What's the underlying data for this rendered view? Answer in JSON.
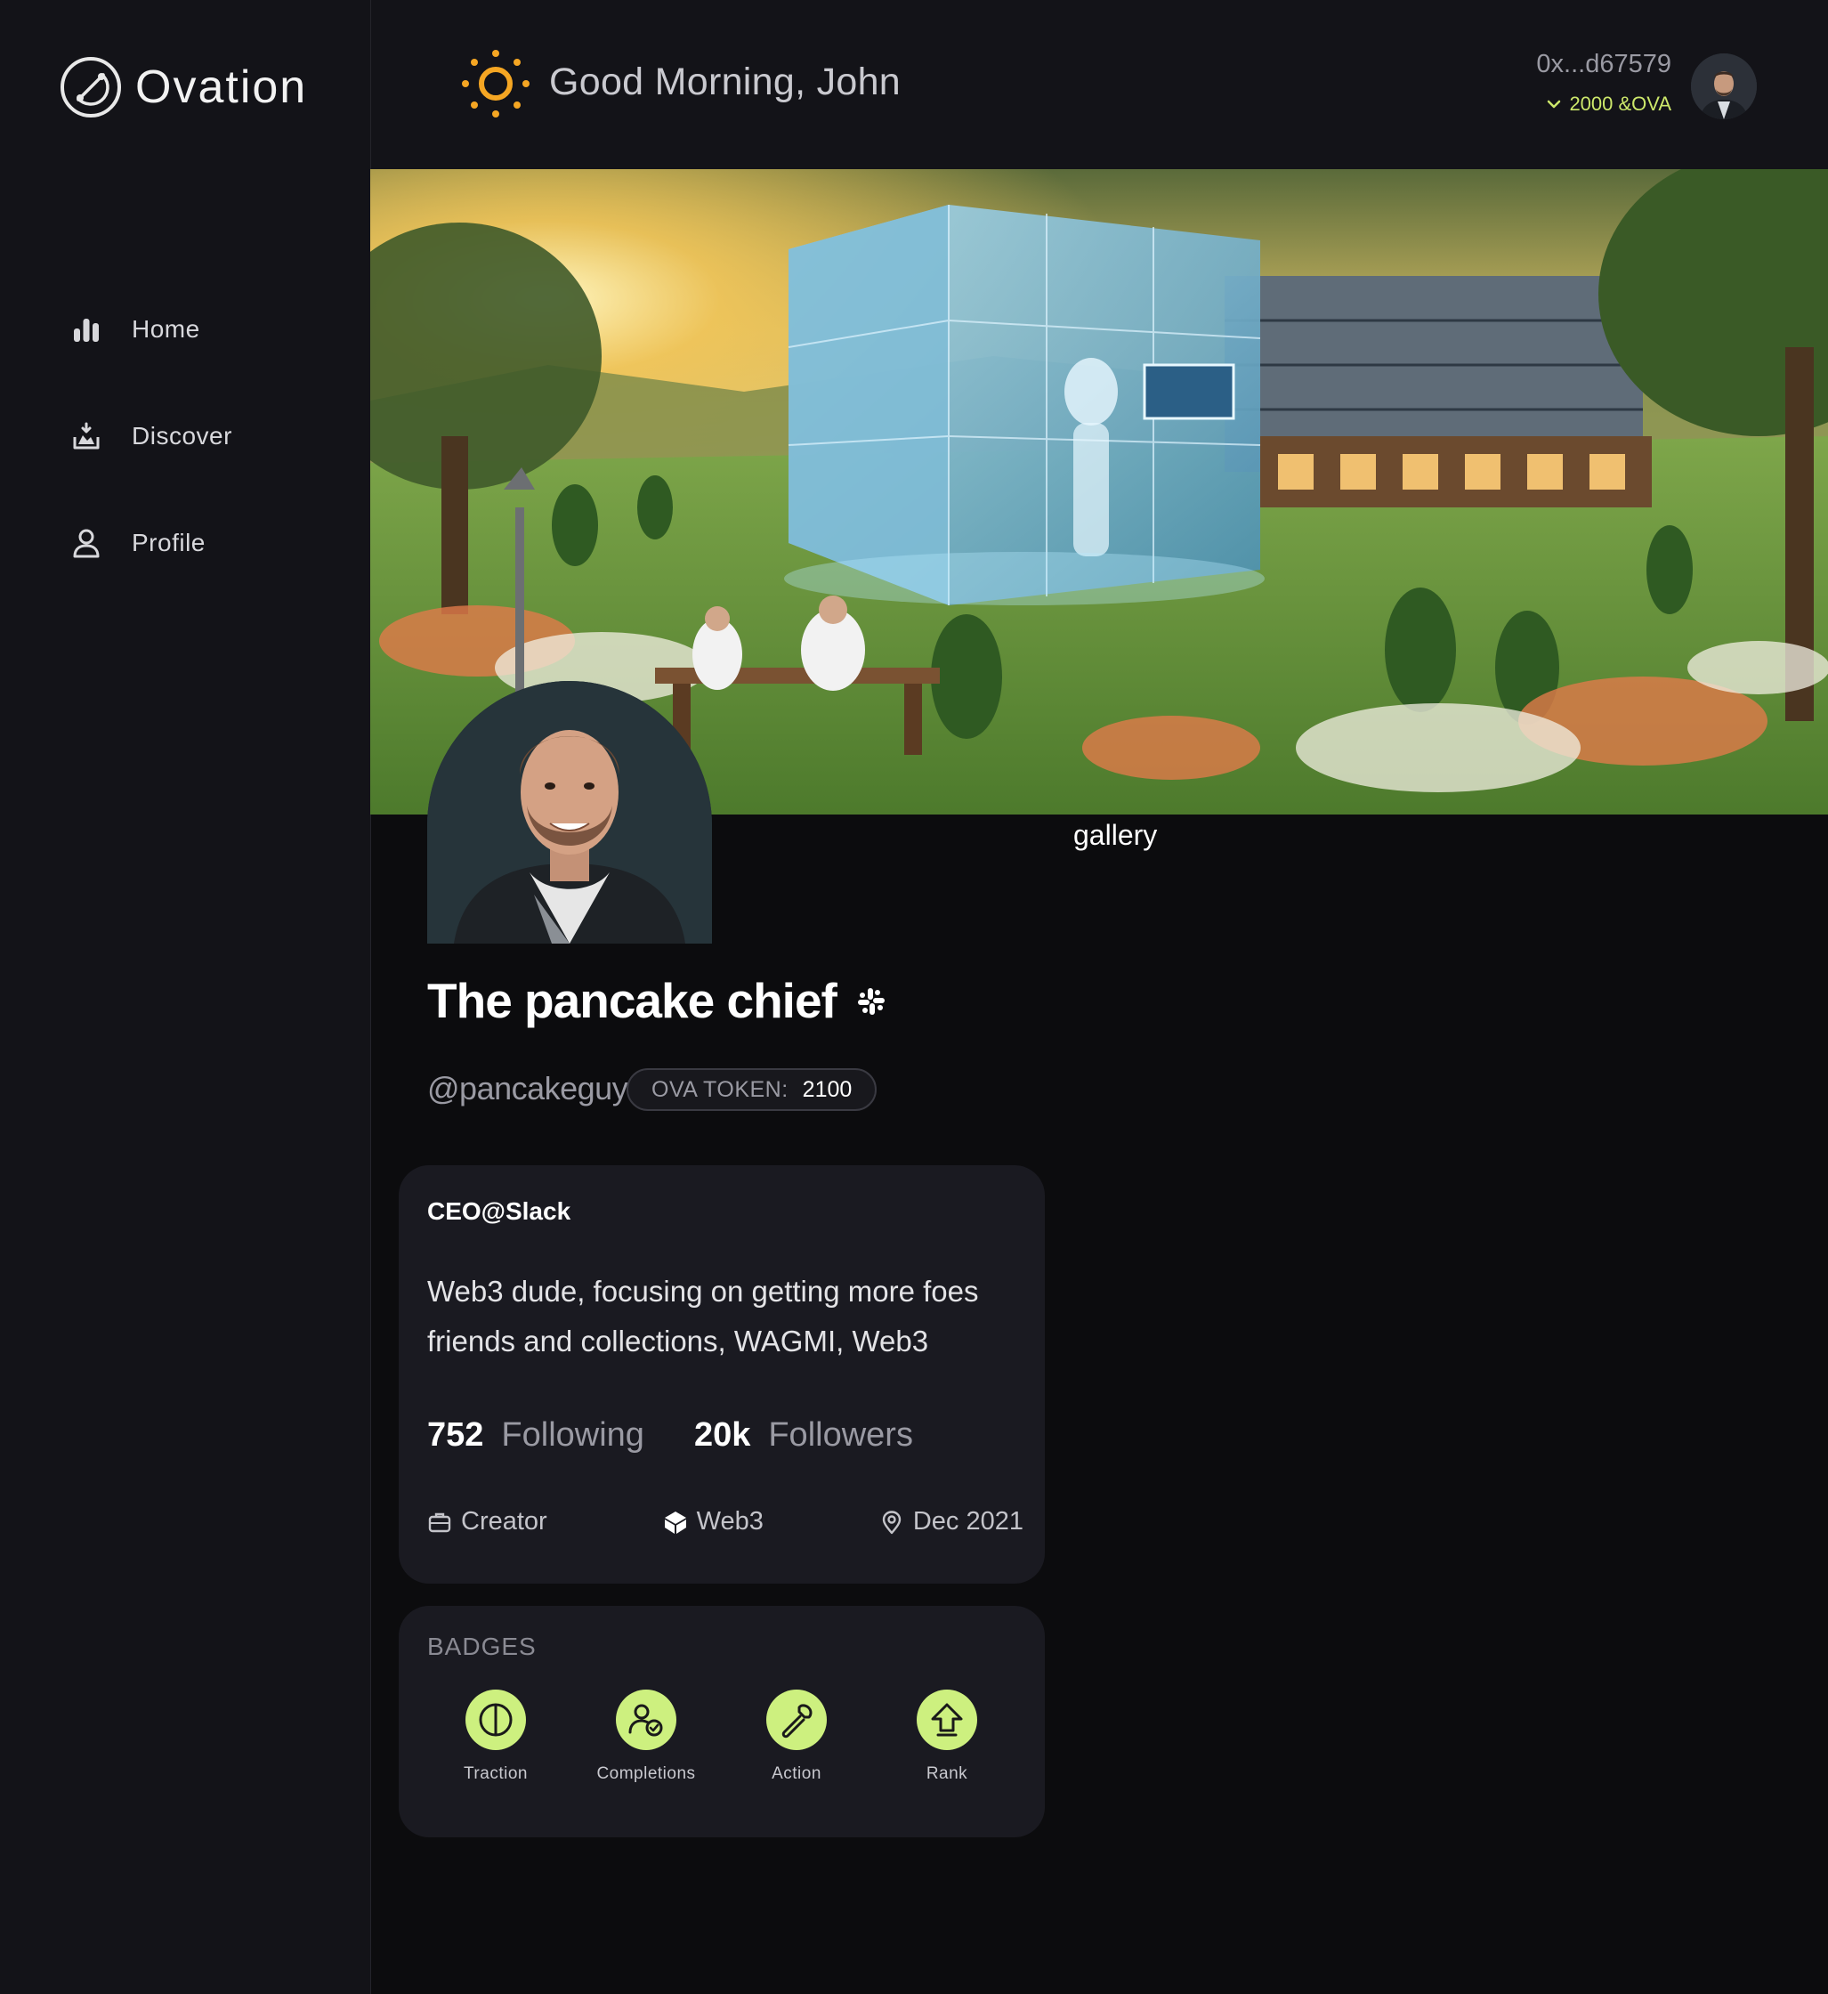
{
  "app": {
    "name": "Ovation"
  },
  "sidebar": {
    "items": [
      {
        "label": "Home",
        "icon": "bar-chart-icon"
      },
      {
        "label": "Discover",
        "icon": "discover-icon"
      },
      {
        "label": "Profile",
        "icon": "user-icon"
      }
    ]
  },
  "header": {
    "greeting": "Good Morning, John",
    "wallet_address": "0x...d67579",
    "wallet_balance": "2000 &OVA"
  },
  "gallery": {
    "label": "gallery"
  },
  "profile": {
    "display_name": "The pancake chief",
    "handle": "@pancakeguy",
    "token_label": "OVA TOKEN:",
    "token_value": "2100"
  },
  "bio": {
    "title": "CEO@Slack",
    "text": "Web3 dude, focusing on getting more foes friends and collections, WAGMI, Web3",
    "following_count": "752",
    "following_label": "Following",
    "followers_count": "20k",
    "followers_label": "Followers",
    "meta": [
      {
        "label": "Creator",
        "icon": "briefcase-icon"
      },
      {
        "label": "Web3",
        "icon": "cube-icon"
      },
      {
        "label": "Dec 2021",
        "icon": "location-pin-icon"
      }
    ]
  },
  "badges": {
    "title": "BADGES",
    "items": [
      {
        "label": "Traction",
        "icon": "traction-icon"
      },
      {
        "label": "Completions",
        "icon": "completions-icon"
      },
      {
        "label": "Action",
        "icon": "wrench-icon"
      },
      {
        "label": "Rank",
        "icon": "rank-up-icon"
      }
    ]
  },
  "colors": {
    "background": "#0c0c0e",
    "sidebar": "#131318",
    "card": "#1a1a21",
    "accent_green": "#cdf07f",
    "sun_orange": "#f5a623"
  }
}
